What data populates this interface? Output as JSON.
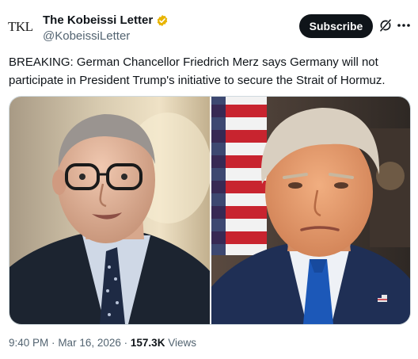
{
  "account": {
    "avatar_text": "TKL",
    "display_name": "The Kobeissi Letter",
    "handle": "@KobeissiLetter"
  },
  "actions": {
    "subscribe_label": "Subscribe",
    "grok_icon": "grok-icon",
    "more_icon": "more-icon"
  },
  "tweet": {
    "text": "BREAKING: German Chancellor Friedrich Merz says Germany will not participate in President Trump's initiative to secure the Strait of Hormuz."
  },
  "media": {
    "items": [
      "photo-merz",
      "photo-trump"
    ]
  },
  "meta": {
    "time": "9:40 PM",
    "separator": "·",
    "date": "Mar 16, 2026",
    "views_count": "157.3K",
    "views_label": "Views"
  },
  "colors": {
    "verified_badge": "#e8b400",
    "button_bg": "#0f1419",
    "secondary_text": "#536471"
  }
}
